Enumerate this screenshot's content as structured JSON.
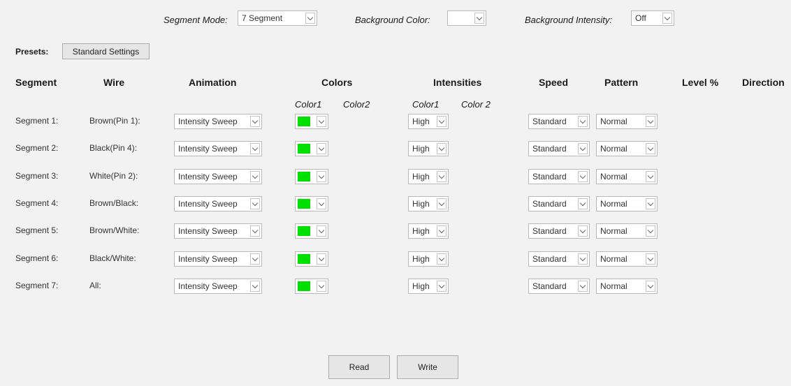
{
  "top": {
    "segment_mode_label": "Segment Mode:",
    "segment_mode_value": "7 Segment",
    "background_color_label": "Background  Color:",
    "background_color_value": "",
    "background_intensity_label": "Background  Intensity:",
    "background_intensity_value": "Off"
  },
  "presets": {
    "label": "Presets:",
    "button": "Standard Settings"
  },
  "headers": {
    "segment": "Segment",
    "wire": "Wire",
    "animation": "Animation",
    "colors": "Colors",
    "intensities": "Intensities",
    "speed": "Speed",
    "pattern": "Pattern",
    "level": "Level %",
    "direction": "Direction",
    "color1": "Color1",
    "color2": "Color2",
    "int_color1": "Color1",
    "int_color2": "Color 2"
  },
  "swatch_color": "#00e000",
  "rows": [
    {
      "segment": "Segment 1:",
      "wire": "Brown(Pin 1):",
      "animation": "Intensity Sweep",
      "intensity": "High",
      "speed": "Standard",
      "pattern": "Normal"
    },
    {
      "segment": "Segment 2:",
      "wire": "Black(Pin 4):",
      "animation": "Intensity Sweep",
      "intensity": "High",
      "speed": "Standard",
      "pattern": "Normal"
    },
    {
      "segment": "Segment 3:",
      "wire": "White(Pin 2):",
      "animation": "Intensity Sweep",
      "intensity": "High",
      "speed": "Standard",
      "pattern": "Normal"
    },
    {
      "segment": "Segment 4:",
      "wire": "Brown/Black:",
      "animation": "Intensity Sweep",
      "intensity": "High",
      "speed": "Standard",
      "pattern": "Normal"
    },
    {
      "segment": "Segment 5:",
      "wire": "Brown/White:",
      "animation": "Intensity Sweep",
      "intensity": "High",
      "speed": "Standard",
      "pattern": "Normal"
    },
    {
      "segment": "Segment 6:",
      "wire": "Black/White:",
      "animation": "Intensity Sweep",
      "intensity": "High",
      "speed": "Standard",
      "pattern": "Normal"
    },
    {
      "segment": "Segment 7:",
      "wire": "All:",
      "animation": "Intensity Sweep",
      "intensity": "High",
      "speed": "Standard",
      "pattern": "Normal"
    }
  ],
  "footer": {
    "read": "Read",
    "write": "Write"
  }
}
